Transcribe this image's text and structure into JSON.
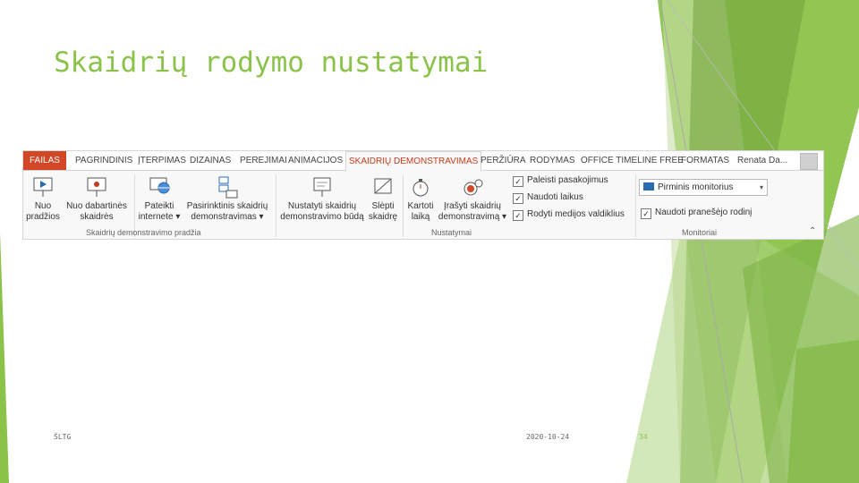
{
  "slide": {
    "title": "Skaidrių rodymo nustatymai",
    "footer_left": "ŠLTG",
    "footer_date": "2020-10-24",
    "page_number": "34"
  },
  "ribbon": {
    "tabs": [
      "FAILAS",
      "PAGRINDINIS",
      "ĮTERPIMAS",
      "DIZAINAS",
      "PEREJIMAI",
      "ANIMACIJOS",
      "SKAIDRIŲ DEMONSTRAVIMAS",
      "PERŽIŪRA",
      "RODYMAS",
      "OFFICE TIMELINE FREE",
      "FORMATAS"
    ],
    "active_tab": "SKAIDRIŲ DEMONSTRAVIMAS",
    "user": "Renata Da...",
    "commands": [
      {
        "line1": "Nuo",
        "line2": "pradžios"
      },
      {
        "line1": "Nuo dabartinės",
        "line2": "skaidrės"
      },
      {
        "line1": "Pateikti",
        "line2": "internete ▾"
      },
      {
        "line1": "Pasirinktinis skaidrių",
        "line2": "demonstravimas ▾"
      },
      {
        "line1": "Nustatyti skaidrių",
        "line2": "demonstravimo būdą"
      },
      {
        "line1": "Slėpti",
        "line2": "skaidrę"
      },
      {
        "line1": "Kartoti",
        "line2": "laiką"
      },
      {
        "line1": "Įrašyti skaidrių",
        "line2": "demonstravimą ▾"
      }
    ],
    "checkboxes": [
      {
        "label": "Paleisti pasakojimus",
        "checked": true
      },
      {
        "label": "Naudoti laikus",
        "checked": true
      },
      {
        "label": "Rodyti medijos valdiklius",
        "checked": true
      }
    ],
    "monitor_dropdown": "Pirminis monitorius",
    "presenter_view": {
      "label": "Naudoti pranešėjo rodinį",
      "checked": true
    },
    "groups": [
      "Skaidrių demonstravimo pradžia",
      "Nustatymai",
      "Monitoriai"
    ]
  },
  "colors": {
    "accent_green": "#8bc34a",
    "file_tab": "#d24726",
    "active_tab_text": "#c43e1c"
  }
}
